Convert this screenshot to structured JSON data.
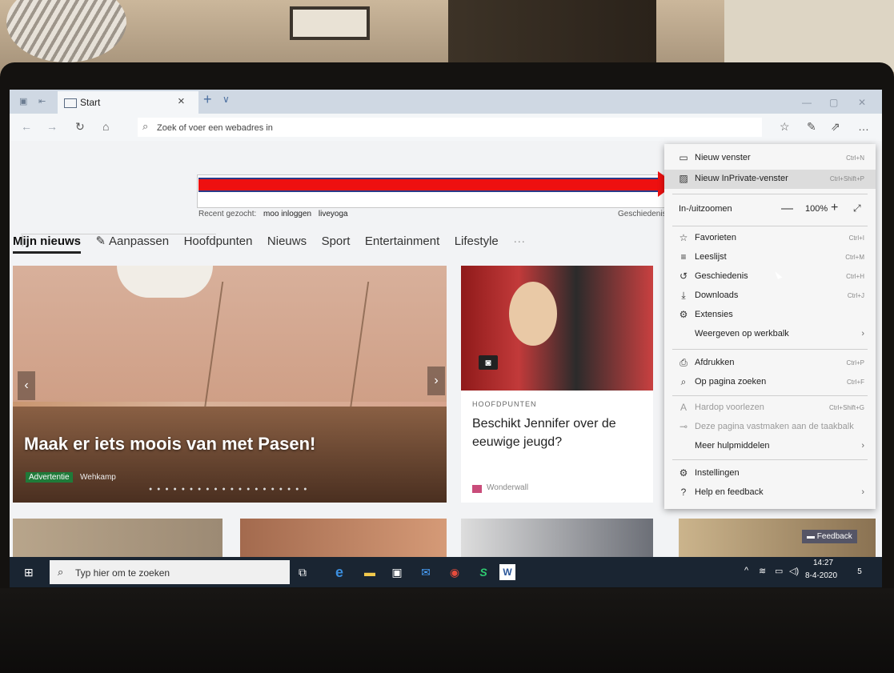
{
  "browser": {
    "tab_title": "Start",
    "tab_close": "×",
    "new_tab": "+",
    "tab_list": "∨",
    "address_placeholder": "Zoek of voer een webadres in"
  },
  "page": {
    "recent_label": "Recent gezocht:",
    "recent_items": [
      "moo inloggen",
      "liveyoga"
    ],
    "history_link": "Geschiedenis",
    "news_nav": {
      "active": "Mijn nieuws",
      "customize": "Aanpassen",
      "items": [
        "Hoofdpunten",
        "Nieuws",
        "Sport",
        "Entertainment",
        "Lifestyle"
      ],
      "more": "···"
    },
    "hero": {
      "headline": "Maak er iets moois van met Pasen!",
      "badge": "Advertentie",
      "sponsor": "Wehkamp"
    },
    "card2": {
      "category": "HOOFDPUNTEN",
      "title": "Beschikt Jennifer over de eeuwige jeugd?",
      "source": "Wonderwall"
    },
    "feedback": "Feedback"
  },
  "menu": {
    "items": [
      {
        "label": "Nieuw venster",
        "shortcut": "Ctrl+N",
        "icon": "window-icon"
      },
      {
        "label": "Nieuw InPrivate-venster",
        "shortcut": "Ctrl+Shift+P",
        "icon": "inprivate-icon"
      },
      {
        "label": "Favorieten",
        "shortcut": "Ctrl+I",
        "icon": "favorites-icon"
      },
      {
        "label": "Leeslijst",
        "shortcut": "Ctrl+M",
        "icon": "reading-list-icon"
      },
      {
        "label": "Geschiedenis",
        "shortcut": "Ctrl+H",
        "icon": "history-icon"
      },
      {
        "label": "Downloads",
        "shortcut": "Ctrl+J",
        "icon": "download-icon"
      },
      {
        "label": "Extensies",
        "shortcut": "",
        "icon": "extensions-icon"
      },
      {
        "label": "Weergeven op werkbalk",
        "shortcut": "",
        "icon": ""
      },
      {
        "label": "Afdrukken",
        "shortcut": "Ctrl+P",
        "icon": "print-icon"
      },
      {
        "label": "Op pagina zoeken",
        "shortcut": "Ctrl+F",
        "icon": "find-icon"
      },
      {
        "label": "Hardop voorlezen",
        "shortcut": "Ctrl+Shift+G",
        "icon": "read-aloud-icon"
      },
      {
        "label": "Deze pagina vastmaken aan de taakbalk",
        "shortcut": "",
        "icon": "pin-icon"
      },
      {
        "label": "Meer hulpmiddelen",
        "shortcut": "",
        "icon": ""
      },
      {
        "label": "Instellingen",
        "shortcut": "",
        "icon": "settings-icon"
      },
      {
        "label": "Help en feedback",
        "shortcut": "",
        "icon": "help-icon"
      }
    ],
    "zoom": {
      "label": "In-/uitzoomen",
      "minus": "—",
      "value": "100%",
      "plus": "+"
    }
  },
  "taskbar": {
    "search_placeholder": "Typ hier om te zoeken",
    "time": "14:27",
    "date": "8-4-2020",
    "notifications": "5"
  }
}
